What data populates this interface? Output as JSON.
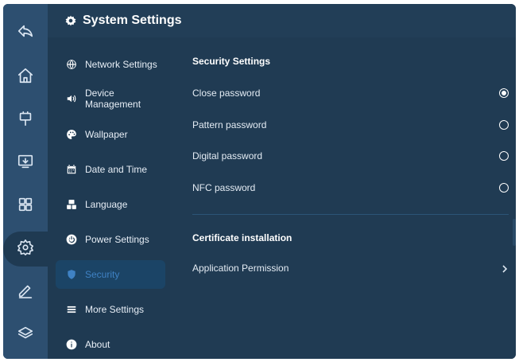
{
  "header": {
    "title": "System Settings",
    "icon": "gear-icon"
  },
  "rail": [
    {
      "name": "back-icon"
    },
    {
      "name": "home-icon"
    },
    {
      "name": "usb-icon"
    },
    {
      "name": "screen-share-icon"
    },
    {
      "name": "apps-grid-icon"
    },
    {
      "name": "settings-icon",
      "active": true
    },
    {
      "name": "pen-icon"
    },
    {
      "name": "layers-icon"
    }
  ],
  "sidebar": {
    "items": [
      {
        "label": "Network Settings",
        "icon": "globe-icon"
      },
      {
        "label": "Device\nManagement",
        "icon": "speaker-icon"
      },
      {
        "label": "Wallpaper",
        "icon": "palette-icon"
      },
      {
        "label": "Date and Time",
        "icon": "calendar-icon"
      },
      {
        "label": "Language",
        "icon": "language-icon"
      },
      {
        "label": "Power Settings",
        "icon": "power-icon"
      },
      {
        "label": "Security",
        "icon": "shield-icon",
        "active": true
      },
      {
        "label": "More Settings",
        "icon": "menu-icon"
      },
      {
        "label": "About",
        "icon": "info-icon"
      }
    ]
  },
  "security": {
    "heading": "Security Settings",
    "options": [
      {
        "label": "Close password",
        "selected": true
      },
      {
        "label": "Pattern password",
        "selected": false
      },
      {
        "label": "Digital password",
        "selected": false
      },
      {
        "label": "NFC password",
        "selected": false
      }
    ]
  },
  "certificate": {
    "heading": "Certificate installation",
    "items": [
      {
        "label": "Application Permission"
      }
    ]
  },
  "colors": {
    "rail": "#2d4f70",
    "background": "#1f3a52",
    "active_item": "#1b4466",
    "accent": "#3f82c4",
    "text": "#e7eef6"
  }
}
